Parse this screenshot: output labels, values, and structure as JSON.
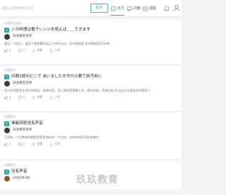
{
  "header": {
    "search_placeholder": "请输入您要搜索的内容",
    "search_button": "提问",
    "nav": [
      {
        "label": "首页",
        "icon": "home-icon",
        "active": true
      },
      {
        "label": "问答",
        "icon": "qa-icon",
        "active": false
      },
      {
        "label": "话题",
        "icon": "topic-icon",
        "active": false
      }
    ]
  },
  "questions": [
    {
      "tag": "日语学习方法",
      "title": "この料理は電子レンジを使えば＿＿できます",
      "author": "日语课堂老师",
      "excerpt": "提示：今创于，温度于宽数幕同加上个单不自对，但对数度度,也对数度度10分钟",
      "stats": {
        "likes": "0",
        "comments": "0",
        "favorite": "收藏",
        "share": "分享"
      }
    },
    {
      "tag": "日语学习",
      "title": "问题2提问どこで 会いましたか为什么要で用不用に",
      "author": "日语课堂老师",
      "excerpt": "用で的话是是在地点的原因，各哪在那，而に表的是事情人名，是在时候，用者也很 所以会去句里面说到要用で",
      "stats": {
        "likes": "0",
        "comments": "0",
        "favorite": "收藏",
        "share": "分享"
      }
    },
    {
      "tag": "日语学习",
      "title": "谁能回答这有声音",
      "author": "日语课堂老师",
      "excerpt": "已经有一个回教老师都是很是更加好的一个回应，去单有和声音的准确吗",
      "stats": {
        "likes": "0",
        "comments": "0",
        "favorite": "收藏",
        "share": "分享"
      }
    },
    {
      "tag": "日语学习",
      "title": "没有声音",
      "author": "zd0936-88",
      "excerpt": "",
      "stats": null
    }
  ],
  "watermark": "玖玖教育",
  "colors": {
    "accent": "#3aa597",
    "tag": "#6a9bd1",
    "question_mark": "#3aa597"
  }
}
